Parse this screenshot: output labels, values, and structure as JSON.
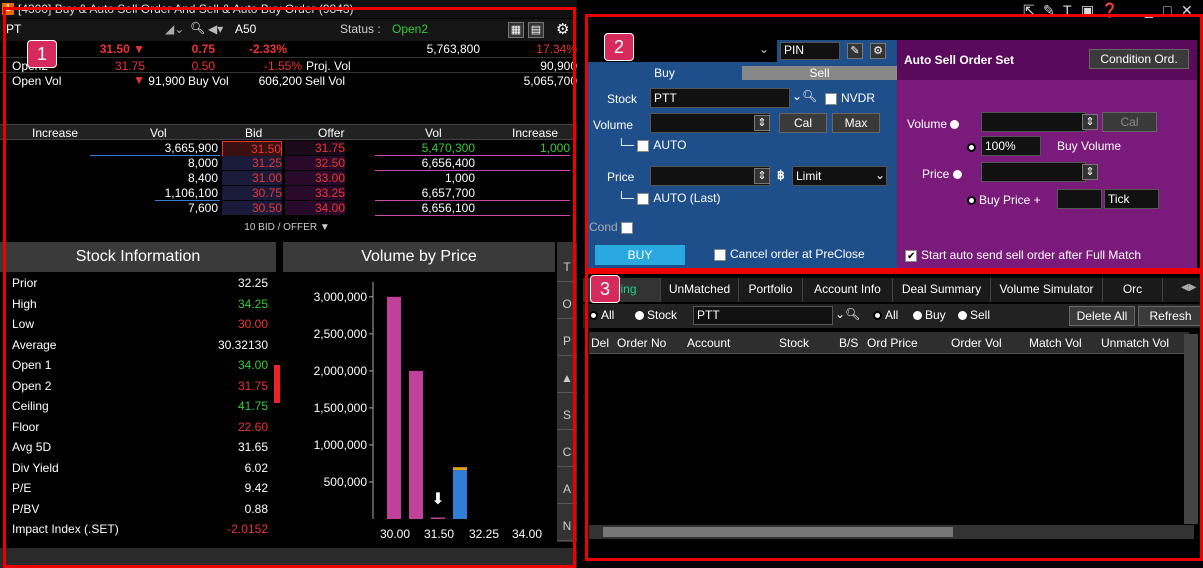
{
  "panel1": {
    "title": "[4300] Buy & Auto Sell Order And Sell & Auto Buy Order (9843)",
    "title_badge": "1",
    "symbol_prefix": "PT",
    "market_label": "A50",
    "status_label": "Status :",
    "status_value": "Open2",
    "quote_row1": [
      "31.50 ▼",
      "0.75",
      "-2.33%",
      "5,763,800",
      "17.34%"
    ],
    "quote_row2": {
      "label": "Open2",
      "v1": "31.75 ▼",
      "v2": "0.50",
      "v3": "-1.55%",
      "label2": "Proj. Vol",
      "v4": "90,900"
    },
    "quote_row3": {
      "label": "Open Vol",
      "v1": "91,900",
      "label2": "Buy Vol",
      "v2": "606,200",
      "label3": "Sell Vol",
      "v3": "5,065,700"
    },
    "book_headers": [
      "Increase",
      "Vol",
      "Bid",
      "Offer",
      "Vol",
      "Increase"
    ],
    "book_rows": [
      {
        "bvol": "3,665,900",
        "bid": "31.50",
        "offer": "31.75",
        "ovol": "5,470,300",
        "inc": "1,000"
      },
      {
        "bvol": "8,000",
        "bid": "31.25",
        "offer": "32.50",
        "ovol": "6,656,400",
        "inc": ""
      },
      {
        "bvol": "8,400",
        "bid": "31.00",
        "offer": "33.00",
        "ovol": "1,000",
        "inc": ""
      },
      {
        "bvol": "1,106,100",
        "bid": "30.75",
        "offer": "33.25",
        "ovol": "6,657,700",
        "inc": ""
      },
      {
        "bvol": "7,600",
        "bid": "30.50",
        "offer": "34.00",
        "ovol": "6,656,100",
        "inc": ""
      }
    ],
    "book_footer": "10 BID / OFFER ▼",
    "stock_info_title": "Stock Information",
    "stock_info": [
      {
        "label": "Prior",
        "value": "32.25",
        "color": "#ffffff"
      },
      {
        "label": "High",
        "value": "34.25",
        "color": "#33cc33"
      },
      {
        "label": "Low",
        "value": "30.00",
        "color": "#ee3333"
      },
      {
        "label": "Average",
        "value": "30.32130",
        "color": "#ffffff"
      },
      {
        "label": "Open 1",
        "value": "34.00",
        "color": "#33cc33"
      },
      {
        "label": "Open 2",
        "value": "31.75",
        "color": "#ee3333"
      },
      {
        "label": "Ceiling",
        "value": "41.75",
        "color": "#33cc33"
      },
      {
        "label": "Floor",
        "value": "22.60",
        "color": "#ee3333"
      },
      {
        "label": "Avg 5D",
        "value": "31.65",
        "color": "#ffffff"
      },
      {
        "label": "Div Yield",
        "value": "6.02",
        "color": "#ffffff"
      },
      {
        "label": "P/E",
        "value": "9.42",
        "color": "#ffffff"
      },
      {
        "label": "P/BV",
        "value": "0.88",
        "color": "#ffffff"
      },
      {
        "label": "Impact Index (.SET)",
        "value": "-2.0152",
        "color": "#ee3333"
      }
    ],
    "side_tabs": [
      "T",
      "O",
      "P",
      "▲",
      "S",
      "C",
      "A",
      "N"
    ]
  },
  "chart_data": {
    "type": "bar",
    "title": "Volume by Price",
    "y_ticks": [
      "3,000,000",
      "2,500,000",
      "2,000,000",
      "1,500,000",
      "1,000,000",
      "500,000"
    ],
    "x_labels": [
      "30.00",
      "31.50",
      "32.25",
      "34.00"
    ],
    "ylim": [
      0,
      3200000
    ],
    "bars": [
      {
        "price": "30.00",
        "value": 3000000,
        "color": "#c0409a"
      },
      {
        "price": "30.75",
        "value": 2000000,
        "color": "#c0409a"
      },
      {
        "price": "31.50",
        "value": 20000,
        "color": "#c0409a"
      },
      {
        "price": "31.75",
        "value": 660000,
        "color": "#2f7fd6",
        "top_value": 40000,
        "top_color": "#e0a020"
      }
    ]
  },
  "panel2": {
    "badge": "2",
    "pin_label": "PIN",
    "tab_buy": "Buy",
    "tab_sell": "Sell",
    "stock_label": "Stock",
    "stock_value": "PTT",
    "nvdr_label": "NVDR",
    "volume_label": "Volume",
    "cal_label": "Cal",
    "max_label": "Max",
    "auto_label": "AUTO",
    "price_label": "Price",
    "baht_label": "฿",
    "price_type": "Limit",
    "auto_last_label": "AUTO (Last)",
    "cond_label": "Cond",
    "buy_button": "BUY",
    "cancel_label": "Cancel order at PreClose",
    "auto_sell_title": "Auto Sell Order Set",
    "condition_button": "Condition Ord.",
    "as_volume_label": "Volume",
    "as_cal_label": "Cal",
    "as_percent": "100%",
    "as_buy_volume": "Buy Volume",
    "as_price_label": "Price",
    "as_buy_price": "Buy Price +",
    "as_tick": "Tick",
    "start_auto_label": "Start auto send sell order after Full Match"
  },
  "panel3": {
    "badge": "3",
    "tabs": [
      "toring",
      "UnMatched",
      "Portfolio",
      "Account Info",
      "Deal Summary",
      "Volume Simulator",
      "Orc"
    ],
    "filter_all": "All",
    "filter_stock": "Stock",
    "filter_stock_value": "PTT",
    "side_all": "All",
    "side_buy": "Buy",
    "side_sell": "Sell",
    "delete_all": "Delete All",
    "refresh": "Refresh",
    "columns": [
      "Del",
      "Order No",
      "Account",
      "Stock",
      "B/S",
      "Ord Price",
      "Order Vol",
      "Match Vol",
      "Unmatch Vol"
    ]
  },
  "colors": {
    "buy_panel": "#1f4f8a",
    "sell_panel": "#7a1a7a",
    "frame": "#ee0000",
    "badge": "#d62a5c"
  }
}
